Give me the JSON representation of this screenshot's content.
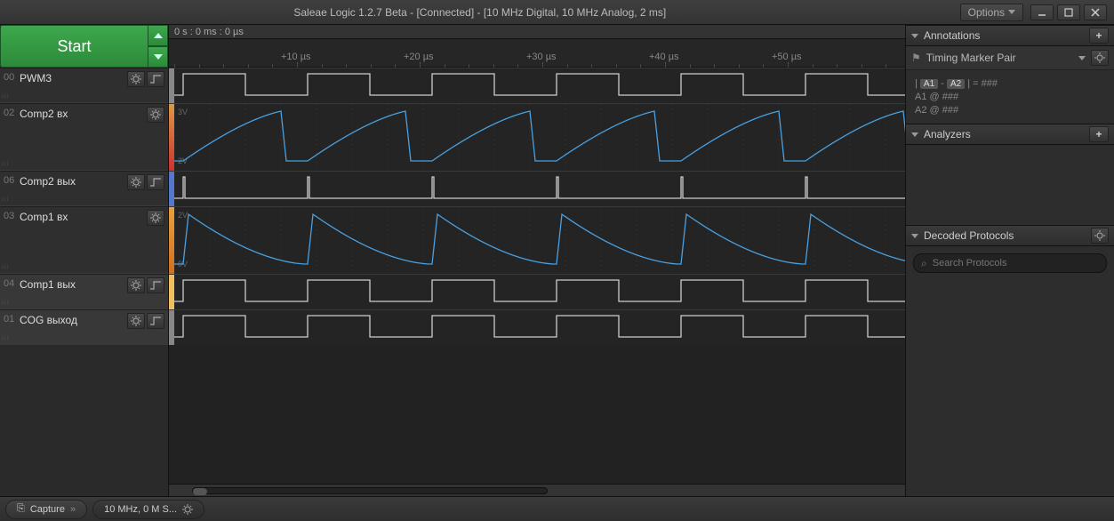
{
  "title": "Saleae Logic 1.2.7 Beta - [Connected] - [10 MHz Digital, 10 MHz Analog, 2 ms]",
  "options_label": "Options",
  "start_label": "Start",
  "timebar": "0 s : 0 ms : 0 µs",
  "ruler_ticks": [
    "+10 µs",
    "+20 µs",
    "+30 µs",
    "+40 µs",
    "+50 µs"
  ],
  "channels": [
    {
      "idx": "00",
      "name": "PWM3",
      "h": 40,
      "type": "digital",
      "trigger": true,
      "strip": "#888",
      "sel": false
    },
    {
      "idx": "02",
      "name": "Comp2 вх",
      "h": 76,
      "type": "analog_saw",
      "trigger": false,
      "strip": "linear-gradient(#d94,#c33)",
      "sel": false,
      "y1": "3V",
      "y2": "2V"
    },
    {
      "idx": "06",
      "name": "Comp2 вых",
      "h": 40,
      "type": "pulse",
      "trigger": true,
      "strip": "#5577cc",
      "sel": false
    },
    {
      "idx": "03",
      "name": "Comp1 вх",
      "h": 76,
      "type": "analog_saw2",
      "trigger": false,
      "strip": "linear-gradient(#e9a040,#d07020)",
      "sel": false,
      "y1": "2V",
      "y2": "0V"
    },
    {
      "idx": "04",
      "name": "Comp1 вых",
      "h": 40,
      "type": "digital",
      "trigger": true,
      "strip": "#f0c060",
      "sel": true
    },
    {
      "idx": "01",
      "name": "COG выход",
      "h": 40,
      "type": "digital",
      "trigger": true,
      "strip": "#888",
      "sel": true
    }
  ],
  "right": {
    "annotations": "Annotations",
    "marker_pair": "Timing Marker Pair",
    "a1": "A1",
    "a2": "A2",
    "sep": " - ",
    "eq": " |  =  ###",
    "a1line": "A1  @  ###",
    "a2line": "A2  @  ###",
    "analyzers": "Analyzers",
    "decoded": "Decoded Protocols",
    "search_ph": "Search Protocols"
  },
  "bottom": {
    "capture": "Capture",
    "settings": "10 MHz, 0 M S..."
  },
  "colors": {
    "wave": "#ccc",
    "analog": "#4aa0e0"
  }
}
